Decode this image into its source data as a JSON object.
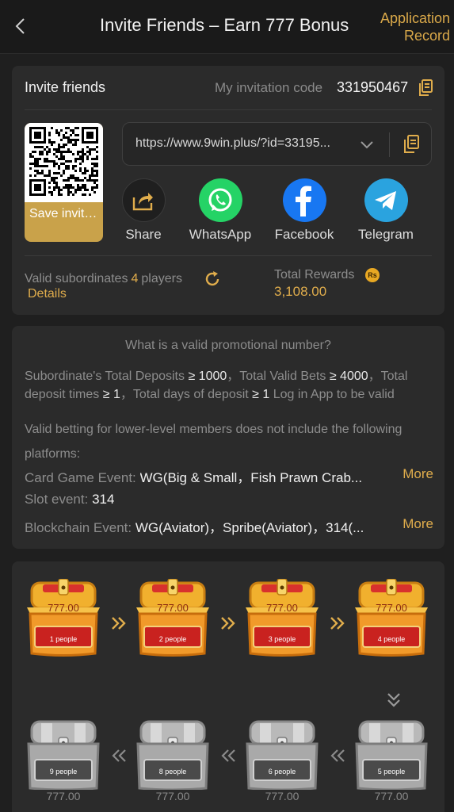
{
  "header": {
    "title": "Invite Friends – Earn 777 Bonus",
    "record_label": "Application Record"
  },
  "invite": {
    "title": "Invite friends",
    "code_label": "My invitation code",
    "code_value": "331950467",
    "save_label": "Save invitation...",
    "link": "https://www.9win.plus/?id=33195...",
    "share": [
      {
        "label": "Share",
        "icon": "share-icon"
      },
      {
        "label": "WhatsApp",
        "icon": "whatsapp-icon",
        "color": "#25d366"
      },
      {
        "label": "Facebook",
        "icon": "facebook-icon",
        "color": "#1877f2"
      },
      {
        "label": "Telegram",
        "icon": "telegram-icon",
        "color": "#2aa3df"
      }
    ],
    "valid_label": "Valid subordinates",
    "valid_count": "4",
    "valid_unit": "players",
    "details_label": "Details",
    "rewards_label": "Total Rewards",
    "currency_badge": "Rs",
    "rewards_value": "3,108.00"
  },
  "rules": {
    "title": "What is a valid promotional number?",
    "cond_1a": "Subordinate's Total Deposits ",
    "cond_1b": "≥ 1000",
    "cond_1c": "，Total Valid Bets ",
    "cond_1d": "≥ 4000",
    "cond_1e": "，Total deposit times ",
    "cond_1f": "≥ 1",
    "cond_1g": "，Total days of deposit ",
    "cond_1h": "≥ 1",
    "cond_1i": " Log in App to be valid",
    "note": "Valid betting for lower-level members does not include the following platforms:",
    "platforms": [
      {
        "label": "Card Game Event: ",
        "value": "WG(Big & Small，Fish Prawn Crab...",
        "more": "More"
      },
      {
        "label": "Slot event: ",
        "value": "314",
        "more": ""
      },
      {
        "label": "Blockchain Event: ",
        "value": "WG(Aviator)，Spribe(Aviator)，314(...",
        "more": "More"
      }
    ]
  },
  "chests": {
    "amount": "777.00",
    "top_row": [
      "1 people",
      "2 people",
      "3 people",
      "4 people"
    ],
    "bottom_row": [
      "9 people",
      "8 people",
      "6 people",
      "5 people"
    ],
    "unlocked_color": "#f1b02e",
    "locked_color": "#b9b9b9"
  },
  "colors": {
    "accent": "#e0ad4c",
    "background": "#1f1f1f",
    "card": "#2b2b2b"
  }
}
